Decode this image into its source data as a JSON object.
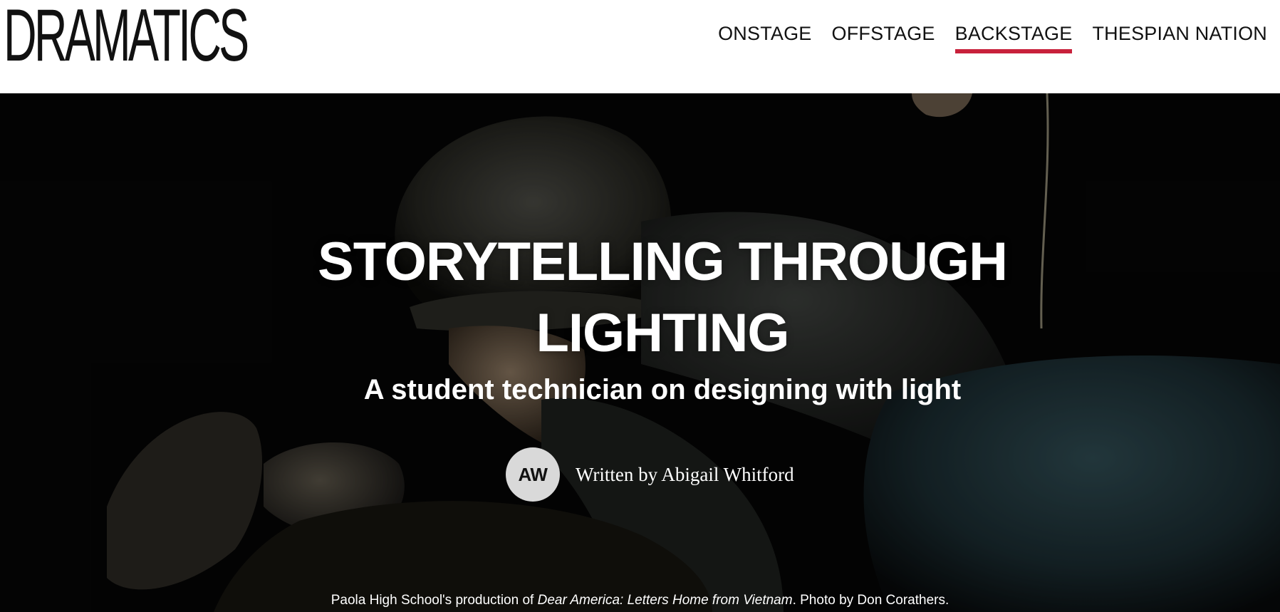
{
  "header": {
    "logo_text": "DRAMATICS",
    "nav": [
      {
        "label": "ONSTAGE",
        "active": false
      },
      {
        "label": "OFFSTAGE",
        "active": false
      },
      {
        "label": "BACKSTAGE",
        "active": true
      },
      {
        "label": "THESPIAN NATION",
        "active": false
      }
    ],
    "active_underline_color": "#c8213b"
  },
  "article": {
    "title": "STORYTELLING THROUGH LIGHTING",
    "subtitle": "A student technician on designing with light",
    "author_initials": "AW",
    "byline": "Written by Abigail Whitford"
  },
  "photo": {
    "caption_prefix": "Paola High School's production of ",
    "caption_title": "Dear America: Letters Home from Vietnam",
    "caption_suffix": ". Photo by Don Corathers."
  }
}
